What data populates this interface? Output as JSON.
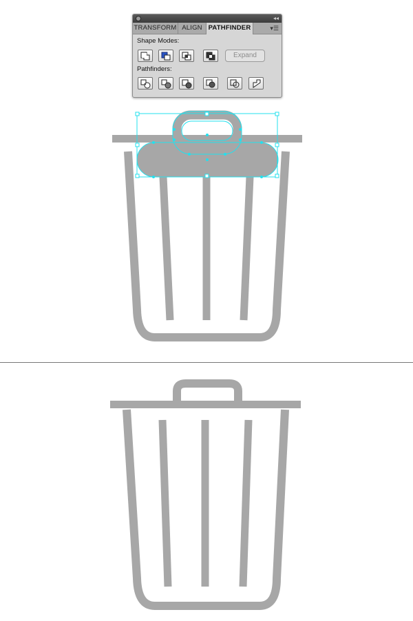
{
  "panel": {
    "tabs": [
      {
        "label": "TRANSFORM",
        "active": false
      },
      {
        "label": "ALIGN",
        "active": false
      },
      {
        "label": "PATHFINDER",
        "active": true
      }
    ],
    "shape_modes_label": "Shape Modes:",
    "pathfinders_label": "Pathfinders:",
    "expand_label": "Expand",
    "shape_mode_buttons": [
      "unite-icon",
      "minus-front-icon",
      "intersect-icon",
      "exclude-icon"
    ],
    "pathfinder_buttons": [
      "divide-icon",
      "trim-icon",
      "merge-icon",
      "crop-icon",
      "outline-icon",
      "minus-back-icon"
    ]
  },
  "colors": {
    "icon_gray": "#a7a7a7",
    "selection_cyan": "#22e0ee",
    "panel_bg": "#d6d6d6",
    "highlight_blue": "#2a56c8"
  }
}
